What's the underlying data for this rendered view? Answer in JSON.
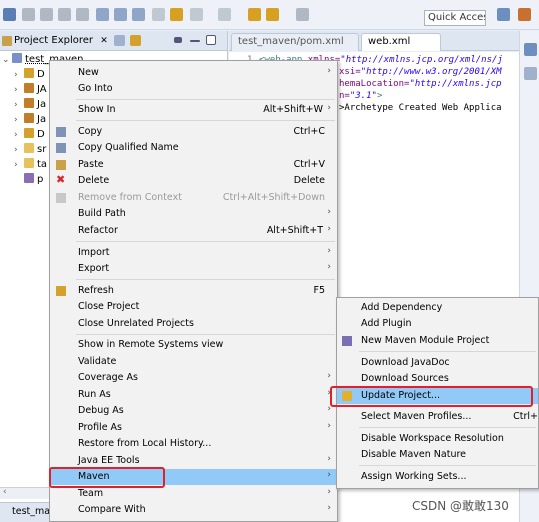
{
  "toolbar": {
    "quick_access": "Quick Access"
  },
  "explorer": {
    "title": "Project Explorer",
    "close_glyph": "✕",
    "root": "test_maven",
    "children": [
      "D",
      "JA",
      "Ja",
      "Ja",
      "D",
      "sr",
      "ta",
      "p"
    ]
  },
  "editor": {
    "tabs": [
      "test_maven/pom.xml",
      "web.xml"
    ],
    "line_number": "1",
    "code": {
      "l1_tag": "<web-app",
      "l1_attr": " xmlns=",
      "l1_val": "\"http://xmlns.jcp.org/xml/ns/j",
      "l2_attr": "xsi=",
      "l2_val": "\"http://www.w3.org/2001/XM",
      "l3_attr": "hemaLocation=",
      "l3_val": "\"http://xmlns.jcp",
      "l4_attr": "n=",
      "l4_val": "\"3.1\"",
      "l4_end": ">",
      "l5": ">Archetype Created Web Applica"
    }
  },
  "context_menu": {
    "items": [
      {
        "label": "New",
        "shortcut": "",
        "arrow": "›"
      },
      {
        "label": "Go Into",
        "shortcut": "",
        "arrow": ""
      },
      {
        "label": "Show In",
        "shortcut": "Alt+Shift+W",
        "arrow": "›"
      },
      {
        "label": "Copy",
        "shortcut": "Ctrl+C",
        "arrow": ""
      },
      {
        "label": "Copy Qualified Name",
        "shortcut": "",
        "arrow": ""
      },
      {
        "label": "Paste",
        "shortcut": "Ctrl+V",
        "arrow": ""
      },
      {
        "label": "Delete",
        "shortcut": "Delete",
        "arrow": ""
      },
      {
        "label": "Remove from Context",
        "shortcut": "Ctrl+Alt+Shift+Down",
        "arrow": ""
      },
      {
        "label": "Build Path",
        "shortcut": "",
        "arrow": "›"
      },
      {
        "label": "Refactor",
        "shortcut": "Alt+Shift+T",
        "arrow": "›"
      },
      {
        "label": "Import",
        "shortcut": "",
        "arrow": "›"
      },
      {
        "label": "Export",
        "shortcut": "",
        "arrow": "›"
      },
      {
        "label": "Refresh",
        "shortcut": "F5",
        "arrow": ""
      },
      {
        "label": "Close Project",
        "shortcut": "",
        "arrow": ""
      },
      {
        "label": "Close Unrelated Projects",
        "shortcut": "",
        "arrow": ""
      },
      {
        "label": "Show in Remote Systems view",
        "shortcut": "",
        "arrow": ""
      },
      {
        "label": "Validate",
        "shortcut": "",
        "arrow": ""
      },
      {
        "label": "Coverage As",
        "shortcut": "",
        "arrow": "›"
      },
      {
        "label": "Run As",
        "shortcut": "",
        "arrow": "›"
      },
      {
        "label": "Debug As",
        "shortcut": "",
        "arrow": "›"
      },
      {
        "label": "Profile As",
        "shortcut": "",
        "arrow": "›"
      },
      {
        "label": "Restore from Local History...",
        "shortcut": "",
        "arrow": ""
      },
      {
        "label": "Java EE Tools",
        "shortcut": "",
        "arrow": "›"
      },
      {
        "label": "Maven",
        "shortcut": "",
        "arrow": "›"
      },
      {
        "label": "Team",
        "shortcut": "",
        "arrow": "›"
      },
      {
        "label": "Compare With",
        "shortcut": "",
        "arrow": "›"
      }
    ]
  },
  "maven_submenu": {
    "items": [
      {
        "label": "Add Dependency",
        "shortcut": ""
      },
      {
        "label": "Add Plugin",
        "shortcut": ""
      },
      {
        "label": "New Maven Module Project",
        "shortcut": ""
      },
      {
        "label": "Download JavaDoc",
        "shortcut": ""
      },
      {
        "label": "Download Sources",
        "shortcut": ""
      },
      {
        "label": "Update Project...",
        "shortcut": ""
      },
      {
        "label": "Select Maven Profiles...",
        "shortcut": "Ctrl+"
      },
      {
        "label": "Disable Workspace Resolution",
        "shortcut": ""
      },
      {
        "label": "Disable Maven Nature",
        "shortcut": ""
      },
      {
        "label": "Assign Working Sets...",
        "shortcut": ""
      }
    ]
  },
  "bottom": {
    "tab_label": "test_mav"
  },
  "watermark": "CSDN @敢敢130",
  "colors": {
    "selection": "#91c9f7",
    "highlight_box": "#e0202a"
  }
}
